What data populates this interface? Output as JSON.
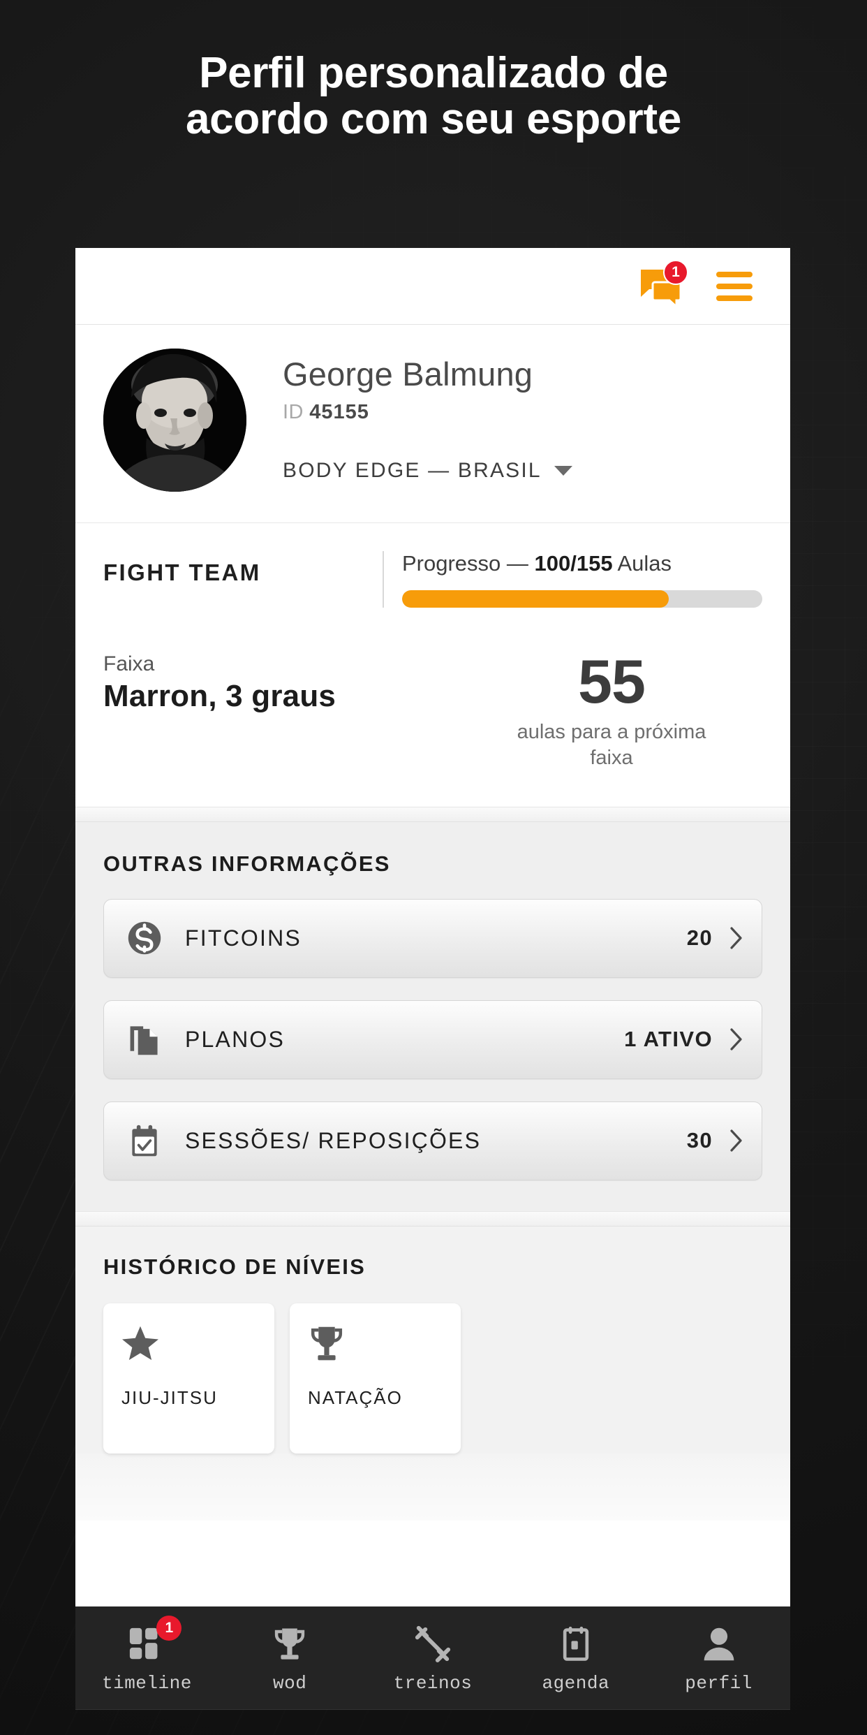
{
  "promo": {
    "headline_line1": "Perfil personalizado de",
    "headline_line2": "acordo com seu esporte"
  },
  "appbar": {
    "chat_badge": "1",
    "chat_icon": "chat-bubbles-icon",
    "menu_icon": "hamburger-menu-icon"
  },
  "profile": {
    "name": "George Balmung",
    "id_label": "ID",
    "id_value": "45155",
    "team": "BODY EDGE — BRASIL",
    "avatar_alt": "user-avatar"
  },
  "fight": {
    "team_title": "FIGHT TEAM",
    "progress_label": "Progresso —",
    "progress_value": "100/155",
    "progress_unit": "Aulas",
    "progress_percent": 74,
    "belt_label": "Faixa",
    "belt_value": "Marron, 3 graus",
    "next_count": "55",
    "next_text_line1": "aulas para a próxima",
    "next_text_line2": "faixa"
  },
  "other_info": {
    "title": "OUTRAS INFORMAÇÕES",
    "rows": [
      {
        "icon": "dollar-coin-icon",
        "label": "FITCOINS",
        "value": "20"
      },
      {
        "icon": "documents-icon",
        "label": "PLANOS",
        "value": "1 ATIVO"
      },
      {
        "icon": "calendar-check-icon",
        "label": "SESSÕES/ REPOSIÇÕES",
        "value": "30"
      }
    ]
  },
  "levels": {
    "title": "HISTÓRICO DE NÍVEIS",
    "cards": [
      {
        "icon": "star-icon",
        "label": "JIU-JITSU"
      },
      {
        "icon": "trophy-icon",
        "label": "NATAÇÃO"
      }
    ]
  },
  "bottom_nav": {
    "items": [
      {
        "icon": "dashboard-grid-icon",
        "label": "timeline",
        "badge": "1"
      },
      {
        "icon": "trophy-icon",
        "label": "wod",
        "badge": ""
      },
      {
        "icon": "dumbbell-icon",
        "label": "treinos",
        "badge": ""
      },
      {
        "icon": "calendar-icon",
        "label": "agenda",
        "badge": ""
      },
      {
        "icon": "person-icon",
        "label": "perfil",
        "badge": ""
      }
    ]
  },
  "colors": {
    "accent": "#F79C0A",
    "badge": "#E8192C",
    "background": "#161616",
    "nav_background": "#242424"
  }
}
